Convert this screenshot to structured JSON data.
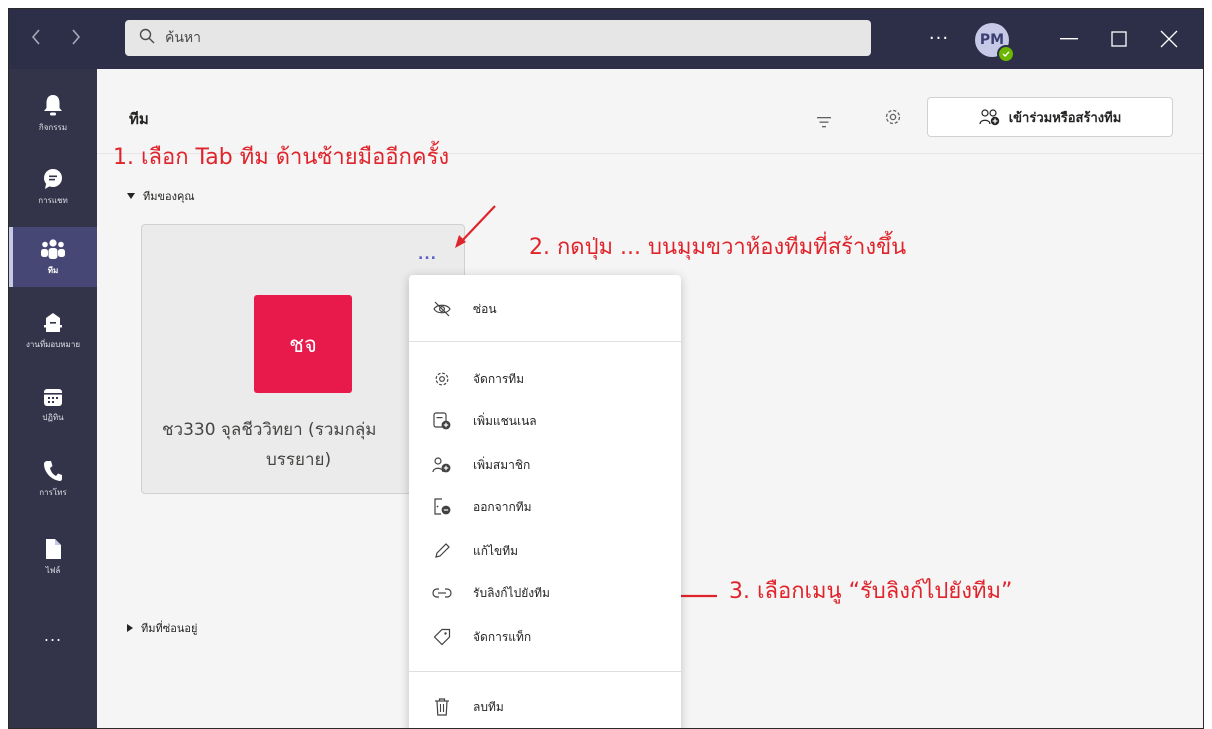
{
  "titlebar": {
    "search_placeholder": "ค้นหา",
    "more_label": "...",
    "avatar_initials": "PM"
  },
  "rail": {
    "items": [
      {
        "label": "กิจกรรม",
        "icon": "bell-icon"
      },
      {
        "label": "การแชท",
        "icon": "chat-icon"
      },
      {
        "label": "ทีม",
        "icon": "teams-icon",
        "active": true
      },
      {
        "label": "งานที่มอบหมาย",
        "icon": "assignments-icon"
      },
      {
        "label": "ปฏิทิน",
        "icon": "calendar-icon"
      },
      {
        "label": "การโทร",
        "icon": "phone-icon"
      },
      {
        "label": "ไฟล์",
        "icon": "file-icon"
      }
    ],
    "more_label": "..."
  },
  "header": {
    "title": "ทีม",
    "join_button_label": "เข้าร่วมหรือสร้างทีม"
  },
  "annotations": {
    "step1": "1. เลือก Tab ทีม ด้านซ้ายมืออีกครั้ง",
    "step2": "2. กดปุ่ม ...  บนมุมขวาห้องทีมที่สร้างขึ้น",
    "step3": "3. เลือกเมนู “รับลิงก์ไปยังทีม”"
  },
  "sections": {
    "your_teams": "ทีมของคุณ",
    "hidden_teams": "ทีมที่ซ่อนอยู่"
  },
  "team_card": {
    "tile_initials": "ชจ",
    "name_line1": "ชว330 จุลชีววิทยา (รวมกลุ่ม",
    "name_line2": "บรรยาย)",
    "more_label": "...",
    "tile_color": "#e8194b"
  },
  "menu": {
    "items": [
      {
        "label": "ซ่อน",
        "icon": "eye-off-icon"
      },
      {
        "label": "จัดการทีม",
        "icon": "gear-icon"
      },
      {
        "label": "เพิ่มแชนเนล",
        "icon": "add-channel-icon"
      },
      {
        "label": "เพิ่มสมาชิก",
        "icon": "add-member-icon"
      },
      {
        "label": "ออกจากทีม",
        "icon": "leave-team-icon"
      },
      {
        "label": "แก้ไขทีม",
        "icon": "pencil-icon"
      },
      {
        "label": "รับลิงก์ไปยังทีม",
        "icon": "link-icon"
      },
      {
        "label": "จัดการแท็ก",
        "icon": "tag-icon"
      },
      {
        "label": "ลบทีม",
        "icon": "trash-icon"
      }
    ]
  },
  "colors": {
    "titlebar": "#2d2f49",
    "rail": "#33344a",
    "accent": "#5b5fc7",
    "annotation": "#e0242b"
  }
}
